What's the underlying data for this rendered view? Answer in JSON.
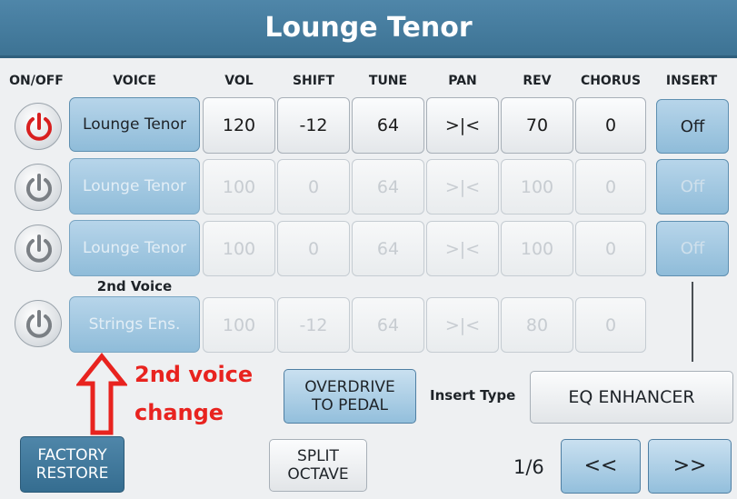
{
  "title": "Lounge Tenor",
  "headers": {
    "onoff": "ON/OFF",
    "voice": "VOICE",
    "vol": "VOL",
    "shift": "SHIFT",
    "tune": "TUNE",
    "pan": "PAN",
    "rev": "REV",
    "chorus": "CHORUS",
    "insert": "INSERT"
  },
  "rows": [
    {
      "voice": "Lounge Tenor",
      "vol": "120",
      "shift": "-12",
      "tune": "64",
      "pan": ">|<",
      "rev": "70",
      "chorus": "0",
      "insert": "Off",
      "power_color": "#d81f1f"
    },
    {
      "voice": "Lounge Tenor",
      "vol": "100",
      "shift": "0",
      "tune": "64",
      "pan": ">|<",
      "rev": "100",
      "chorus": "0",
      "insert": "Off",
      "power_color": "#7a7f84"
    },
    {
      "voice": "Lounge Tenor",
      "vol": "100",
      "shift": "0",
      "tune": "64",
      "pan": ">|<",
      "rev": "100",
      "chorus": "0",
      "insert": "Off",
      "power_color": "#7a7f84"
    },
    {
      "voice": "Strings Ens.",
      "vol": "100",
      "shift": "-12",
      "tune": "64",
      "pan": ">|<",
      "rev": "80",
      "chorus": "0",
      "power_color": "#7a7f84"
    }
  ],
  "second_voice_label": "2nd Voice",
  "annotation": {
    "line1": "2nd voice",
    "line2": "change",
    "color": "#e8231f"
  },
  "buttons": {
    "overdrive_line1": "OVERDRIVE",
    "overdrive_line2": "TO PEDAL",
    "insert_type_label": "Insert Type",
    "insert_type_value": "EQ ENHANCER",
    "factory_line1": "FACTORY",
    "factory_line2": "RESTORE",
    "split_line1": "SPLIT",
    "split_line2": "OCTAVE",
    "page": "1/6",
    "prev": "<<",
    "next": ">>"
  },
  "colors": {
    "header": "#4a80a3",
    "accent": "#8fbcd9",
    "power_on": "#d81f1f",
    "power_off": "#7a7f84"
  },
  "icons": {
    "power": "power-icon",
    "arrow": "up-arrow-icon"
  }
}
